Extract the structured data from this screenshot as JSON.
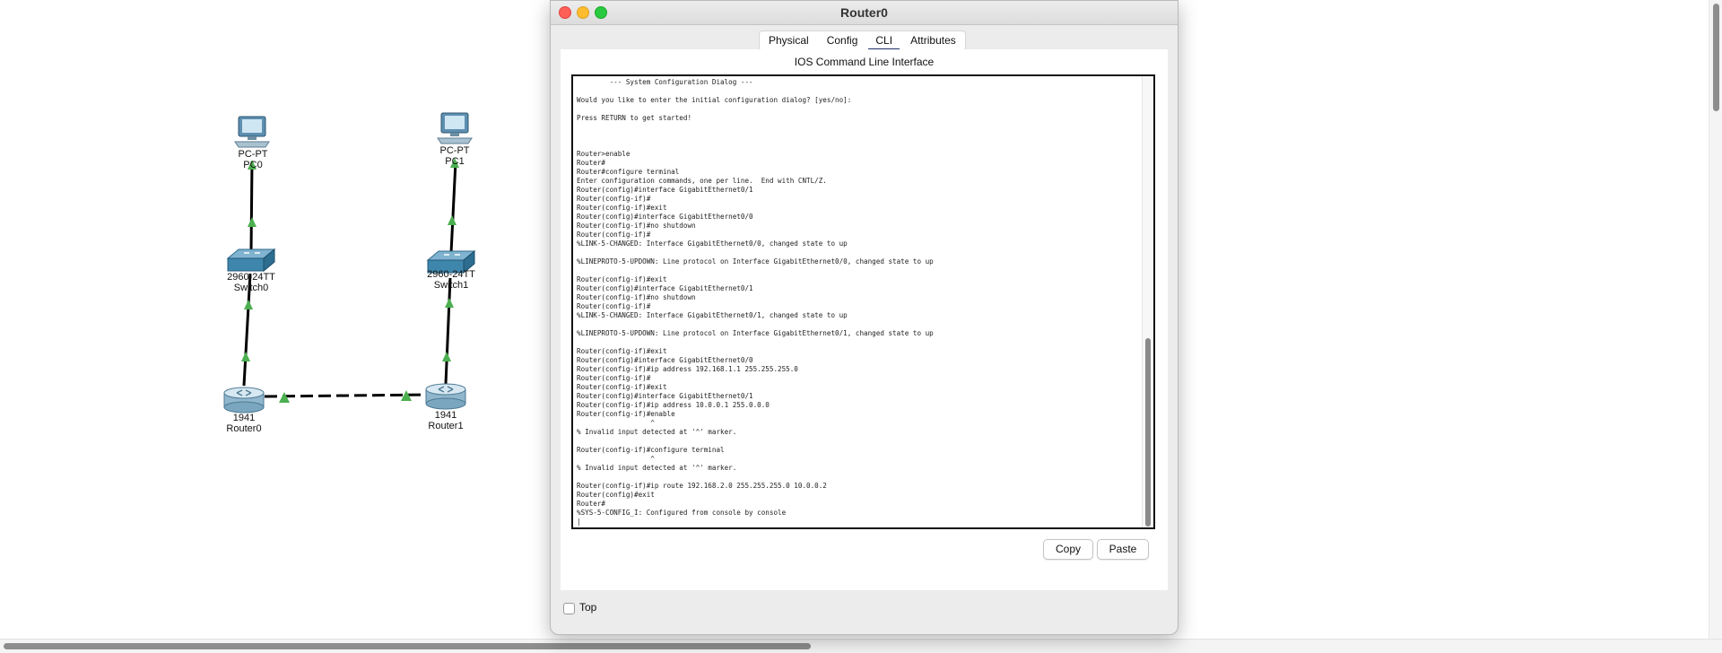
{
  "window": {
    "title": "Router0",
    "tabs": [
      {
        "label": "Physical",
        "active": false
      },
      {
        "label": "Config",
        "active": false
      },
      {
        "label": "CLI",
        "active": true
      },
      {
        "label": "Attributes",
        "active": false
      }
    ],
    "cli_header": "IOS Command Line Interface",
    "terminal_lines": [
      "        --- System Configuration Dialog ---",
      "",
      "Would you like to enter the initial configuration dialog? [yes/no]:",
      "",
      "Press RETURN to get started!",
      "",
      "",
      "",
      "Router>enable",
      "Router#",
      "Router#configure terminal",
      "Enter configuration commands, one per line.  End with CNTL/Z.",
      "Router(config)#interface GigabitEthernet0/1",
      "Router(config-if)#",
      "Router(config-if)#exit",
      "Router(config)#interface GigabitEthernet0/0",
      "Router(config-if)#no shutdown",
      "Router(config-if)#",
      "%LINK-5-CHANGED: Interface GigabitEthernet0/0, changed state to up",
      "",
      "%LINEPROTO-5-UPDOWN: Line protocol on Interface GigabitEthernet0/0, changed state to up",
      "",
      "Router(config-if)#exit",
      "Router(config)#interface GigabitEthernet0/1",
      "Router(config-if)#no shutdown",
      "Router(config-if)#",
      "%LINK-5-CHANGED: Interface GigabitEthernet0/1, changed state to up",
      "",
      "%LINEPROTO-5-UPDOWN: Line protocol on Interface GigabitEthernet0/1, changed state to up",
      "",
      "Router(config-if)#exit",
      "Router(config)#interface GigabitEthernet0/0",
      "Router(config-if)#ip address 192.168.1.1 255.255.255.0",
      "Router(config-if)#",
      "Router(config-if)#exit",
      "Router(config)#interface GigabitEthernet0/1",
      "Router(config-if)#ip address 10.0.0.1 255.0.0.0",
      "Router(config-if)#enable",
      "                  ^",
      "% Invalid input detected at '^' marker.",
      "",
      "Router(config-if)#configure terminal",
      "                  ^",
      "% Invalid input detected at '^' marker.",
      "",
      "Router(config-if)#ip route 192.168.2.0 255.255.255.0 10.0.0.2",
      "Router(config)#exit",
      "Router#",
      "%SYS-5-CONFIG_I: Configured from console by console",
      "|"
    ],
    "copy_label": "Copy",
    "paste_label": "Paste",
    "top_label": "Top",
    "top_checked": false
  },
  "topology": {
    "devices": [
      {
        "name": "pc0",
        "model": "PC-PT",
        "label": "PC0",
        "icon": "pc-icon"
      },
      {
        "name": "pc1",
        "model": "PC-PT",
        "label": "PC1",
        "icon": "pc-icon"
      },
      {
        "name": "switch0",
        "model": "2960-24TT",
        "label": "Switch0",
        "icon": "switch-icon"
      },
      {
        "name": "switch1",
        "model": "2960-24TT",
        "label": "Switch1",
        "icon": "switch-icon"
      },
      {
        "name": "router0",
        "model": "1941",
        "label": "Router0",
        "icon": "router-icon"
      },
      {
        "name": "router1",
        "model": "1941",
        "label": "Router1",
        "icon": "router-icon"
      }
    ],
    "links": [
      {
        "from": "pc0",
        "to": "switch0",
        "type": "straight"
      },
      {
        "from": "switch0",
        "to": "router0",
        "type": "straight"
      },
      {
        "from": "pc1",
        "to": "switch1",
        "type": "straight"
      },
      {
        "from": "switch1",
        "to": "router1",
        "type": "straight"
      },
      {
        "from": "router0",
        "to": "router1",
        "type": "crossover"
      }
    ],
    "link_status_color": "#4caf50"
  }
}
